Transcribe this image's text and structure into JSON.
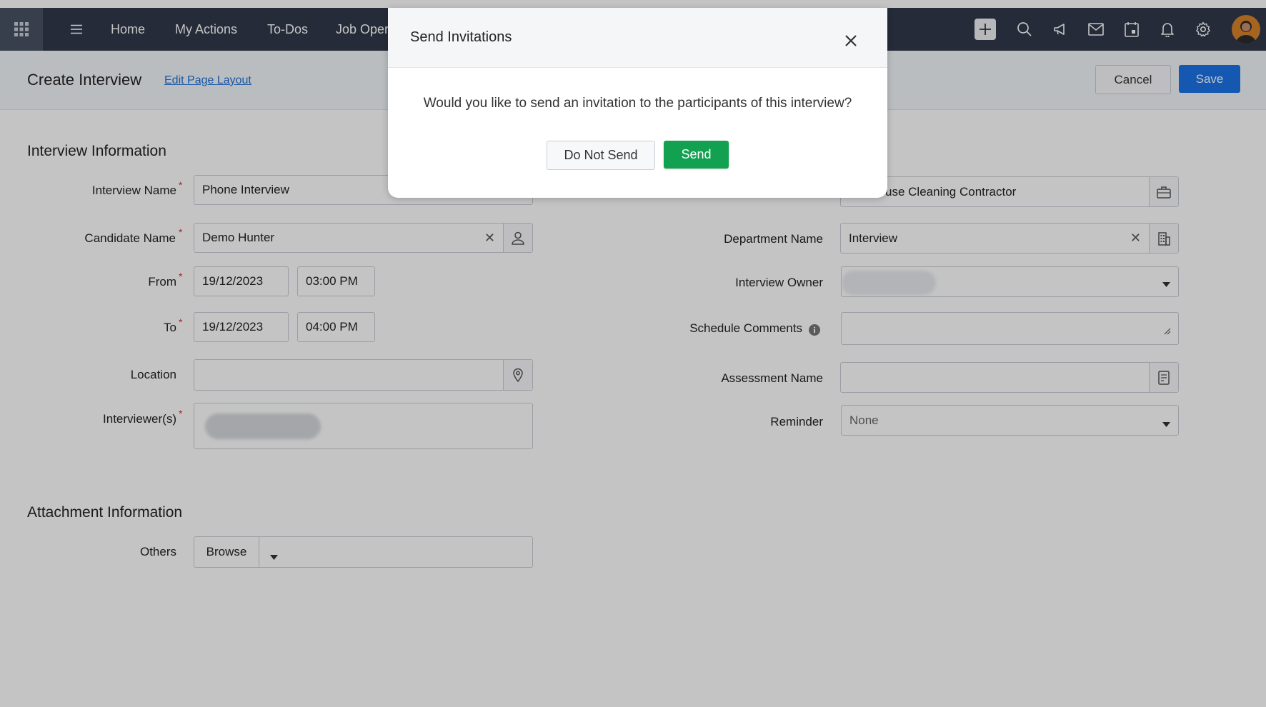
{
  "nav": {
    "items": [
      "Home",
      "My Actions",
      "To-Dos",
      "Job Oper"
    ]
  },
  "header": {
    "title": "Create Interview",
    "edit_layout": "Edit Page Layout",
    "cancel": "Cancel",
    "save": "Save"
  },
  "interview_section": {
    "title": "Interview Information",
    "interview_name_label": "Interview Name",
    "interview_name_value": "Phone Interview",
    "candidate_label": "Candidate Name",
    "candidate_value": "Demo Hunter",
    "from_label": "From",
    "from_date": "19/12/2023",
    "from_time": "03:00 PM",
    "to_label": "To",
    "to_date": "19/12/2023",
    "to_time": "04:00 PM",
    "location_label": "Location",
    "interviewers_label": "Interviewer(s)",
    "job_value": "er / House Cleaning Contractor",
    "department_label": "Department Name",
    "department_value": "Interview",
    "owner_label": "Interview Owner",
    "schedule_comments_label": "Schedule Comments",
    "assessment_label": "Assessment Name",
    "reminder_label": "Reminder",
    "reminder_value": "None"
  },
  "attachment_section": {
    "title": "Attachment Information",
    "others_label": "Others",
    "browse": "Browse"
  },
  "modal": {
    "title": "Send Invitations",
    "message": "Would you like to send an invitation to the participants of this interview?",
    "do_not_send": "Do Not Send",
    "send": "Send"
  },
  "colors": {
    "topbar": "#313949",
    "primary": "#1a73e8",
    "send": "#12a150",
    "required": "#e03030"
  }
}
